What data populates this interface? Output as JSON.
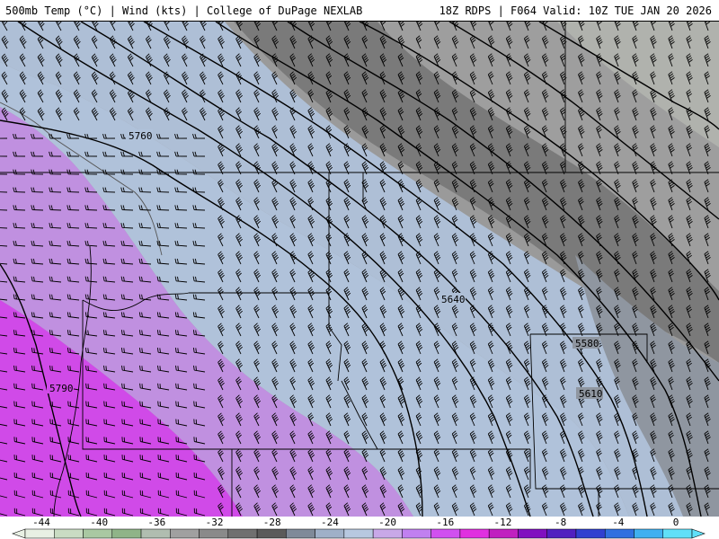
{
  "header": {
    "left_title": "500mb Temp (°C) | Wind (kts) | College of DuPage NEXLAB",
    "right_title": "18Z RDPS | F064 Valid: 10Z TUE JAN 20 2026"
  },
  "contour_labels": [
    "5760",
    "5640",
    "5580",
    "5610",
    "5790"
  ],
  "colorbar": {
    "tick_labels": [
      "-44",
      "-40",
      "-36",
      "-32",
      "-28",
      "-24",
      "-20",
      "-16",
      "-12",
      "-8",
      "-4",
      "0"
    ],
    "colors": [
      "#e8f0e4",
      "#c9dcc3",
      "#a9c8a2",
      "#8fb488",
      "#b0bdb0",
      "#a0a0a0",
      "#8a8a8a",
      "#707070",
      "#5a5a5a",
      "#7f8a99",
      "#9fb0c8",
      "#b7c8e0",
      "#c8a8e8",
      "#c080f0",
      "#d050f0",
      "#e030e0",
      "#c020c0",
      "#8010c0",
      "#5020c0",
      "#3040d0",
      "#3070e0",
      "#40b0f0",
      "#60e0f8"
    ]
  },
  "temperature_field": {
    "units": "°C",
    "zones": [
      "gray (colder, northeast)",
      "light blue (-20 to -16)",
      "light purple (-16 to -12)",
      "magenta (-12 to -8)"
    ]
  },
  "wind_barbs": {
    "units": "kts"
  }
}
